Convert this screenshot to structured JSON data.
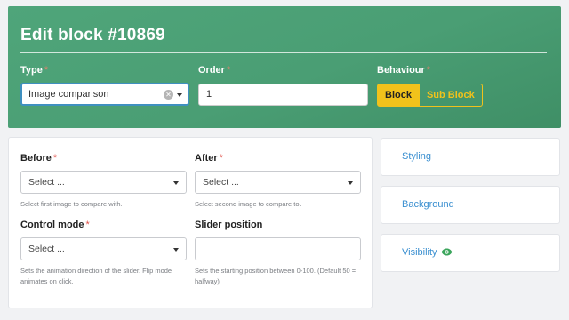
{
  "header": {
    "title": "Edit block #10869",
    "type_label": "Type",
    "type_value": "Image comparison",
    "order_label": "Order",
    "order_value": "1",
    "behaviour_label": "Behaviour",
    "behaviour_options": [
      "Block",
      "Sub Block"
    ],
    "behaviour_selected": "Block",
    "required_mark": "*"
  },
  "form": {
    "before": {
      "label": "Before",
      "placeholder": "Select ...",
      "help": "Select first image to compare with."
    },
    "after": {
      "label": "After",
      "placeholder": "Select ...",
      "help": "Select second image to compare to."
    },
    "control_mode": {
      "label": "Control mode",
      "placeholder": "Select ...",
      "help": "Sets the animation direction of the slider. Flip mode animates on click."
    },
    "slider_position": {
      "label": "Slider position",
      "value": "",
      "help": "Sets the starting position between 0-100. (Default 50 = halfway)"
    }
  },
  "sidebar": {
    "styling": "Styling",
    "background": "Background",
    "visibility": "Visibility"
  },
  "colors": {
    "header_green": "#4a9e74",
    "accent_yellow": "#f1c21b",
    "link_blue": "#3a8fd0",
    "required_red": "#e0524a",
    "eye_green": "#3ba55c"
  },
  "icons": [
    "clear-icon",
    "chevron-down-icon",
    "eye-icon"
  ]
}
